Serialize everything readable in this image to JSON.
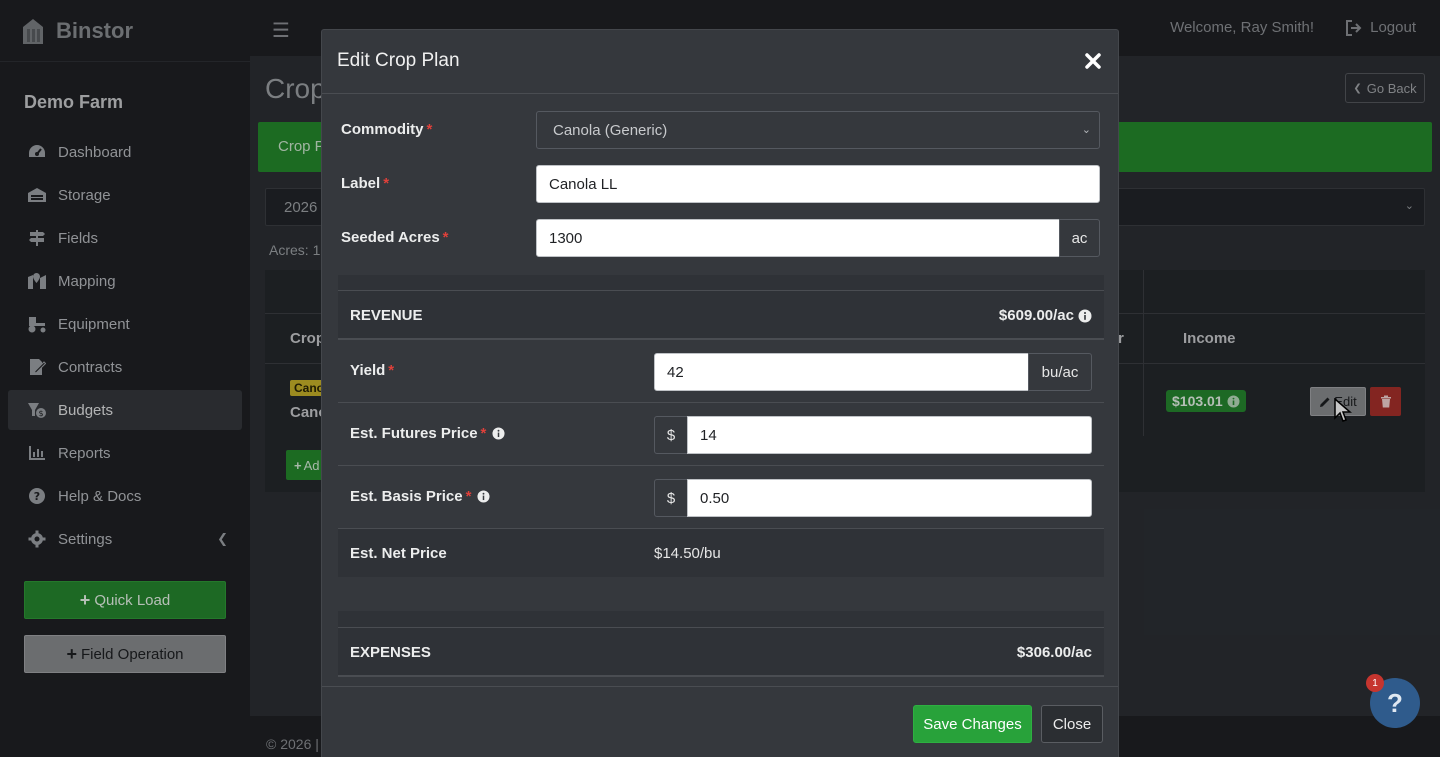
{
  "sidebar": {
    "brand": "Binstor",
    "farm": "Demo Farm",
    "items": [
      {
        "label": "Dashboard",
        "icon": "dashboard-icon"
      },
      {
        "label": "Storage",
        "icon": "warehouse-icon"
      },
      {
        "label": "Fields",
        "icon": "signpost-icon"
      },
      {
        "label": "Mapping",
        "icon": "map-marker-icon"
      },
      {
        "label": "Equipment",
        "icon": "tractor-icon"
      },
      {
        "label": "Contracts",
        "icon": "contract-icon"
      },
      {
        "label": "Budgets",
        "icon": "budget-icon"
      },
      {
        "label": "Reports",
        "icon": "chart-icon"
      },
      {
        "label": "Help & Docs",
        "icon": "question-circle-icon"
      },
      {
        "label": "Settings",
        "icon": "gear-icon"
      }
    ],
    "quick_load": "Quick Load",
    "field_operation": "Field Operation"
  },
  "topbar": {
    "welcome": "Welcome, Ray Smith!",
    "logout": "Logout"
  },
  "background": {
    "page_title": "Crop",
    "go_back": "Go Back",
    "banner_text": "Crop P",
    "year": "2026",
    "acres": "Acres: 1",
    "col_crop": "Crop",
    "col_r": "r",
    "col_income": "Income",
    "row_tag": "Cano",
    "row_name": "Cano",
    "income": "$103.01",
    "edit": "Edit",
    "add": "Ad",
    "footer": "© 2026 |"
  },
  "modal": {
    "title": "Edit Crop Plan",
    "commodity_label": "Commodity",
    "commodity_value": "Canola (Generic)",
    "label_label": "Label",
    "label_value": "Canola LL",
    "acres_label": "Seeded Acres",
    "acres_value": "1300",
    "acres_unit": "ac",
    "revenue": {
      "title": "REVENUE",
      "total": "$609.00/ac",
      "yield_label": "Yield",
      "yield_value": "42",
      "yield_unit": "bu/ac",
      "futures_label": "Est. Futures Price",
      "futures_currency": "$",
      "futures_value": "14",
      "basis_label": "Est. Basis Price",
      "basis_currency": "$",
      "basis_value": "0.50",
      "net_label": "Est. Net Price",
      "net_value": "$14.50/bu"
    },
    "expenses": {
      "title": "EXPENSES",
      "total": "$306.00/ac"
    },
    "save": "Save Changes",
    "close": "Close"
  },
  "help": {
    "badge": "1",
    "glyph": "?"
  },
  "colors": {
    "accent_green": "#28a23a",
    "danger_red": "#a8302b",
    "required_red": "#e0403a"
  }
}
